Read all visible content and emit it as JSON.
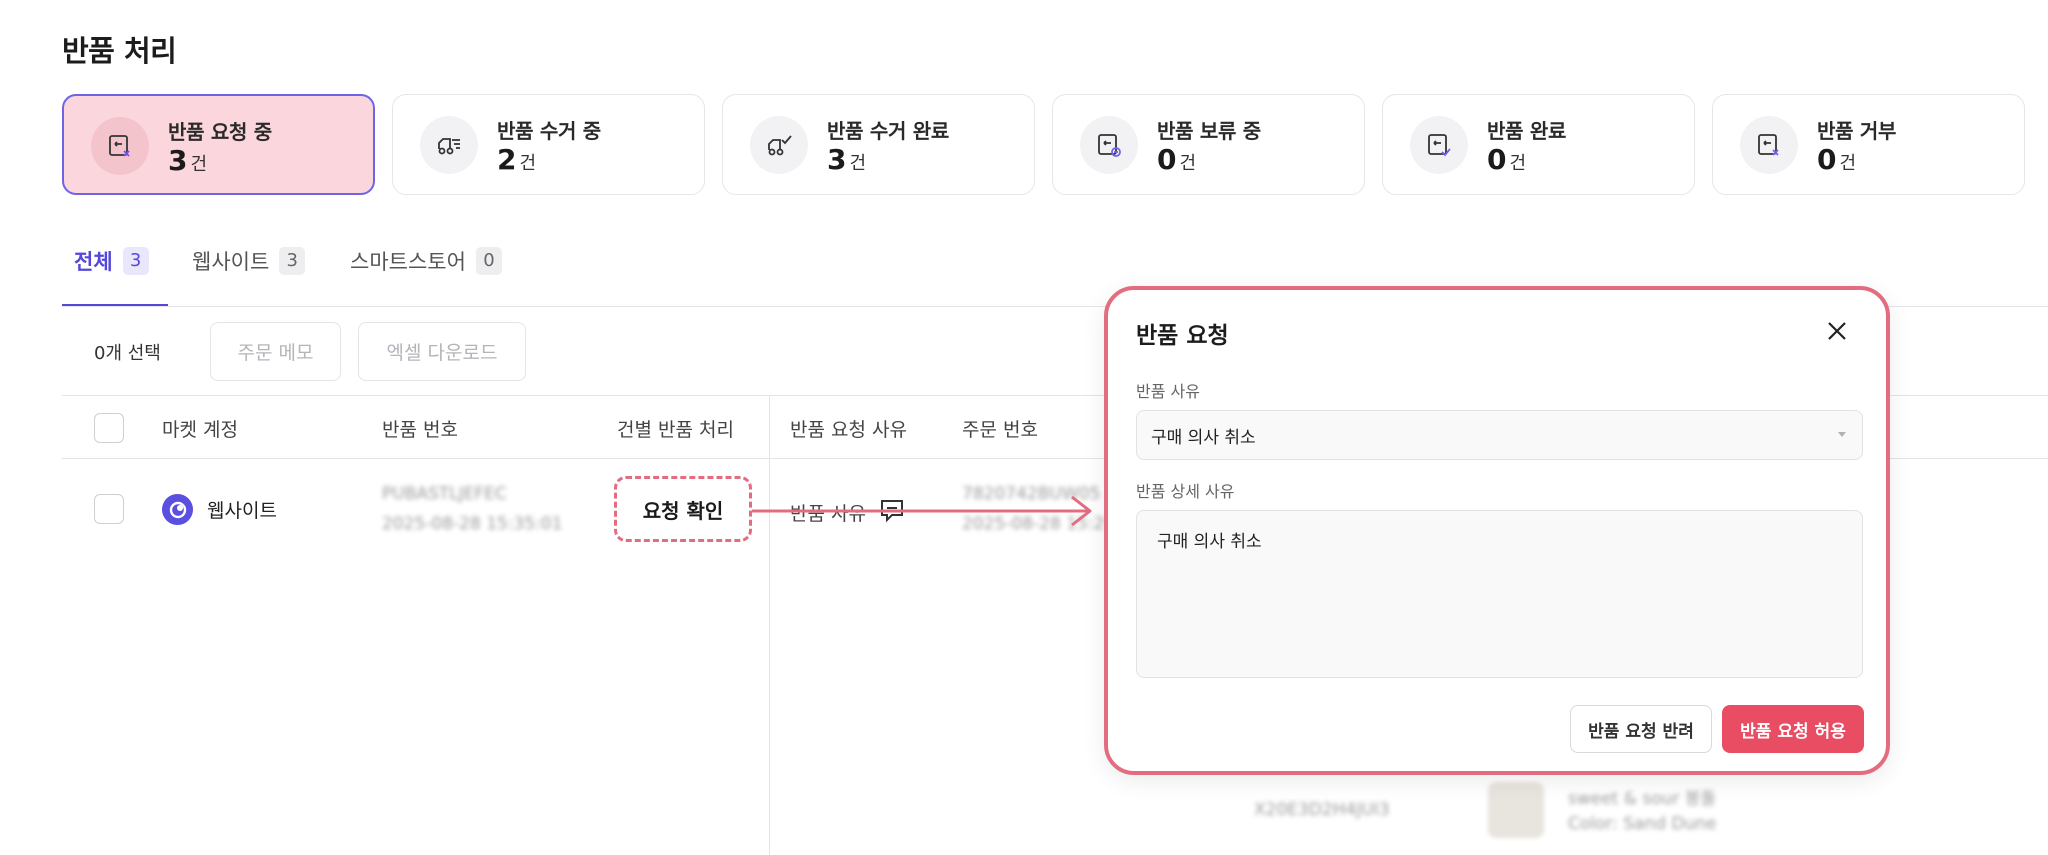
{
  "page": {
    "title": "반품 처리"
  },
  "status_cards": [
    {
      "label": "반품 요청 중",
      "count": "3",
      "unit": "건",
      "icon": "return-request-icon",
      "active": true
    },
    {
      "label": "반품 수거 중",
      "count": "2",
      "unit": "건",
      "icon": "pickup-truck-icon",
      "active": false
    },
    {
      "label": "반품 수거 완료",
      "count": "3",
      "unit": "건",
      "icon": "pickup-done-icon",
      "active": false
    },
    {
      "label": "반품 보류 중",
      "count": "0",
      "unit": "건",
      "icon": "return-hold-icon",
      "active": false
    },
    {
      "label": "반품 완료",
      "count": "0",
      "unit": "건",
      "icon": "return-complete-icon",
      "active": false
    },
    {
      "label": "반품 거부",
      "count": "0",
      "unit": "건",
      "icon": "return-reject-icon",
      "active": false
    }
  ],
  "tabs": [
    {
      "label": "전체",
      "count": "3",
      "active": true
    },
    {
      "label": "웹사이트",
      "count": "3",
      "active": false
    },
    {
      "label": "스마트스토어",
      "count": "0",
      "active": false
    }
  ],
  "toolbar": {
    "selected": "0개 선택",
    "memo_label": "주문 메모",
    "excel_label": "엑셀 다운로드"
  },
  "table": {
    "headers": [
      "마켓 계정",
      "반품 번호",
      "건별 반품 처리",
      "반품 요청 사유",
      "주문 번호"
    ],
    "row": {
      "market": "웹사이트",
      "return_no": "PUBASTLJEFEC",
      "return_date": "2025-08-28 15:35:01",
      "action_label": "요청 확인",
      "reason_label": "반품 사유",
      "order_no": "7820742BUW05",
      "order_date": "2025-08-28 15:25:01"
    },
    "bottom_row": {
      "order_no": "X20E3D2H4JUI3",
      "product_name": "sweet & sour 봉돌",
      "product_option": "Color: Sand Dune"
    }
  },
  "modal": {
    "title": "반품 요청",
    "reason_label": "반품 사유",
    "reason_value": "구매 의사 취소",
    "detail_label": "반품 상세 사유",
    "detail_value": "구매 의사 취소",
    "reject_label": "반품 요청 반려",
    "allow_label": "반품 요청 허용"
  },
  "colors": {
    "accent": "#5548d9",
    "highlight": "#e36d80",
    "allow_button": "#e84d63",
    "active_card_bg": "#fbd6dc"
  }
}
